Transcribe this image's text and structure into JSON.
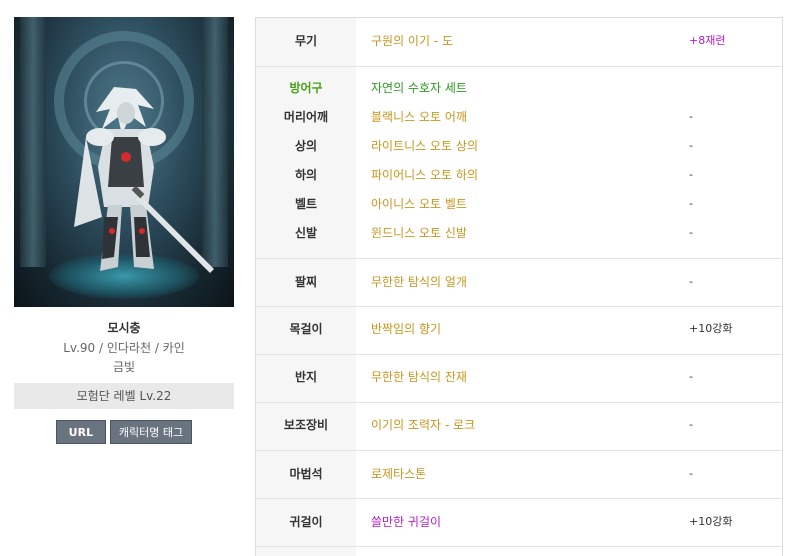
{
  "character": {
    "name": "모시충",
    "info": "Lv.90 / 인다라천 / 카인",
    "guild": "금빛",
    "adventure_level": "모험단 레벨 Lv.22",
    "buttons": {
      "url": "URL",
      "tag": "캐릭터명 태그"
    }
  },
  "equipment": {
    "weapon": {
      "slot": "무기",
      "item": "구원의 이기 - 도",
      "enhance": "+8재련"
    },
    "armor": {
      "header_slot": "방어구",
      "set_name": "자연의 수호자 세트",
      "pieces": [
        {
          "slot": "머리어깨",
          "item": "블랙니스 오토 어깨",
          "enhance": "-"
        },
        {
          "slot": "상의",
          "item": "라이트니스 오토 상의",
          "enhance": "-"
        },
        {
          "slot": "하의",
          "item": "파이어니스 오토 하의",
          "enhance": "-"
        },
        {
          "slot": "벨트",
          "item": "아이니스 오토 벨트",
          "enhance": "-"
        },
        {
          "slot": "신발",
          "item": "윈드니스 오토 신발",
          "enhance": "-"
        }
      ]
    },
    "bracelet": {
      "slot": "팔찌",
      "item": "무한한 탐식의 얼개",
      "enhance": "-"
    },
    "necklace": {
      "slot": "목걸이",
      "item": "반짝임의 향기",
      "enhance": "+10강화"
    },
    "ring": {
      "slot": "반지",
      "item": "무한한 탐식의 잔재",
      "enhance": "-"
    },
    "support": {
      "slot": "보조장비",
      "item": "이기의 조력자 - 로크",
      "enhance": "-"
    },
    "magic_stone": {
      "slot": "마법석",
      "item": "로제타스톤",
      "enhance": "-"
    },
    "earring": {
      "slot": "귀걸이",
      "item": "쓸만한 귀걸이",
      "enhance": "+10강화"
    }
  },
  "colors": {
    "item_epic": "#c8961e",
    "item_set_header": "#46a016",
    "item_unique": "#b31fcc",
    "enhance_purple": "#b31fcc",
    "button_bg": "#6a7380"
  }
}
